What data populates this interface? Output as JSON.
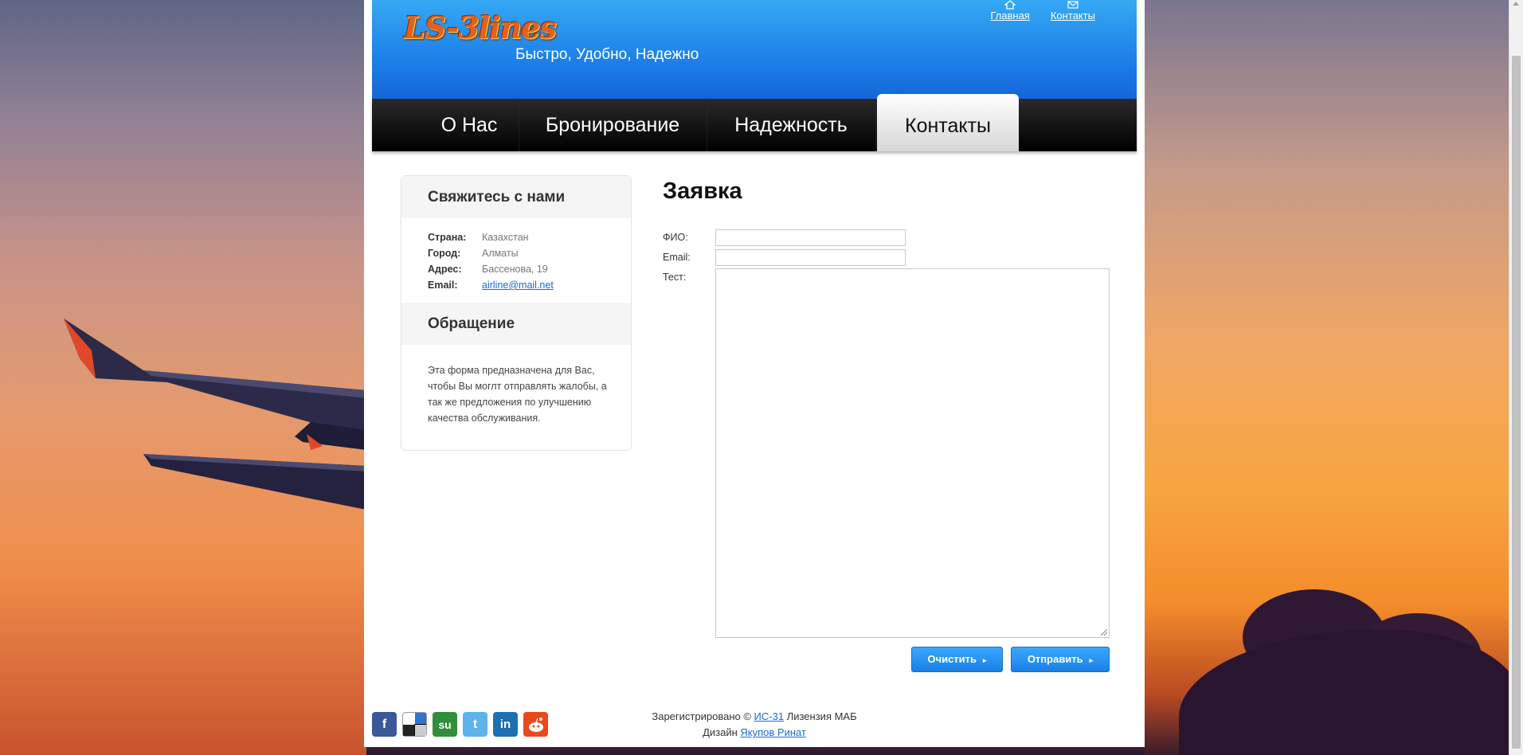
{
  "header": {
    "logo_text": "LS-3lines",
    "tagline": "Быстро, Удобно, Надежно",
    "top_links": [
      {
        "label": "Главная",
        "icon": "home-icon"
      },
      {
        "label": "Контакты",
        "icon": "mail-icon"
      }
    ]
  },
  "nav": {
    "items": [
      {
        "label": "О Нас"
      },
      {
        "label": "Бронирование"
      },
      {
        "label": "Надежность"
      },
      {
        "label": "Контакты"
      }
    ],
    "active": "Контакты"
  },
  "sidebar": {
    "contact_heading": "Свяжитесь с нами",
    "contacts": [
      {
        "key": "Страна:",
        "value": "Казахстан"
      },
      {
        "key": "Город:",
        "value": "Алматы"
      },
      {
        "key": "Адрес:",
        "value": "Бассенова, 19"
      },
      {
        "key": "Email:",
        "value": "airline@mail.net"
      }
    ],
    "appeal_heading": "Обращение",
    "appeal_text": "Эта форма предназначена для Вас, чтобы Вы моглт отправлять жалобы, а так же предложения по улучшению качества обслуживания."
  },
  "form": {
    "title": "Заявка",
    "fields": {
      "name_label": "ФИО:",
      "name_value": "",
      "email_label": "Email:",
      "email_value": "",
      "text_label": "Тест:",
      "text_value": ""
    },
    "clear_label": "Очистить",
    "submit_label": "Отправить"
  },
  "footer": {
    "line1_prefix": "Зарегистрировано ©",
    "line1_link": "ИС-31",
    "line1_suffix": "Лизензия МАБ",
    "line2_prefix": "Дизайн",
    "line2_link": "Якупов Ринат",
    "social": [
      "facebook-icon",
      "delicious-icon",
      "stumbleupon-icon",
      "twitter-icon",
      "linkedin-icon",
      "reddit-icon"
    ]
  },
  "colors": {
    "header_blue": "#1f84ea",
    "button_blue": "#1a7fe8",
    "nav_black": "#000000",
    "link_blue": "#1a6be0"
  }
}
